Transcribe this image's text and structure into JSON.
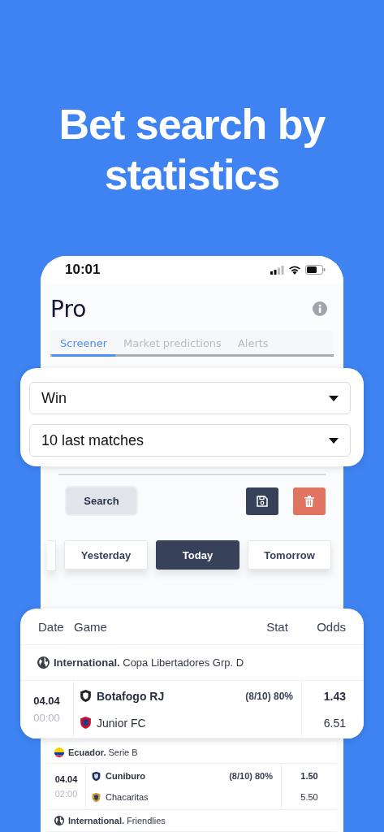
{
  "headline": "Bet search by statistics",
  "status_bar": {
    "time": "10:01"
  },
  "app": {
    "title": "Pro",
    "tabs": [
      {
        "label": "Screener",
        "selected": true
      },
      {
        "label": "Market predictions",
        "selected": false
      },
      {
        "label": "Alerts",
        "selected": false
      }
    ]
  },
  "filters": [
    {
      "value": "Win"
    },
    {
      "value": "10 last matches"
    }
  ],
  "actions": {
    "search": "Search"
  },
  "day_tabs": [
    {
      "label": "Yesterday",
      "selected": false
    },
    {
      "label": "Today",
      "selected": true
    },
    {
      "label": "Tomorrow",
      "selected": false
    }
  ],
  "table": {
    "columns": [
      "Date",
      "Game",
      "Stat",
      "Odds"
    ],
    "groups": [
      {
        "kind": "globe",
        "region": "International.",
        "league": "Copa Libertadores Grp. D",
        "matches": [
          {
            "date": "04.04",
            "time": "00:00",
            "home": "Botafogo RJ",
            "away": "Junior FC",
            "stat": "(8/10) 80%",
            "odds_home": "1.43",
            "odds_away": "6.51"
          }
        ]
      },
      {
        "kind": "flag",
        "region": "Ecuador.",
        "league": "Serie B",
        "matches": [
          {
            "date": "04.04",
            "time": "02:00",
            "home": "Cuniburo",
            "away": "Chacaritas",
            "stat": "(8/10) 80%",
            "odds_home": "1.50",
            "odds_away": "5.50"
          }
        ]
      },
      {
        "kind": "globe",
        "region": "International.",
        "league": "Friendlies"
      }
    ]
  }
}
